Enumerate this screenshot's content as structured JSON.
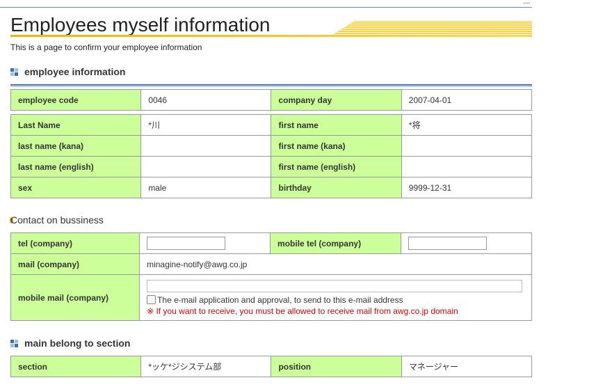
{
  "page": {
    "title": "Employees myself information",
    "subtitle": "This is a page to confirm your employee information"
  },
  "sections": {
    "employee_info": "employee information",
    "contact": "Contact on bussiness",
    "main_section": "main belong to section"
  },
  "employee_code_row": {
    "code_label": "employee code",
    "code_value": "0046",
    "company_day_label": "company day",
    "company_day_value": "2007-04-01"
  },
  "name_rows": {
    "last_name_label": "Last Name",
    "last_name_value": "*川",
    "first_name_label": "first name",
    "first_name_value": "*将",
    "last_kana_label": "last name (kana)",
    "last_kana_value": "",
    "first_kana_label": "first name (kana)",
    "first_kana_value": "",
    "last_en_label": "last name (english)",
    "last_en_value": "",
    "first_en_label": "first name (english)",
    "first_en_value": "",
    "sex_label": "sex",
    "sex_value": "male",
    "birthday_label": "birthday",
    "birthday_value": "9999-12-31"
  },
  "contact": {
    "tel_label": "tel (company)",
    "tel_value": "",
    "mobile_tel_label": "mobile tel (company)",
    "mobile_tel_value": "",
    "mail_label": "mail (company)",
    "mail_value": "minagine-notify@awg.co.jp",
    "mobile_mail_label": "mobile mail (company)",
    "mobile_mail_value": "",
    "approval_checkbox_label": "The e-mail application and approval, to send to this e-mail address",
    "approval_checked": false,
    "warning": "※ If you want to receive, you must be allowed to receive mail from awg.co.jp domain"
  },
  "belong": {
    "section_label": "section",
    "section_value": "*ッケ*ジシステム部",
    "position_label": "position",
    "position_value": "マネージャー"
  },
  "colors": {
    "label_bg": "#ccff99",
    "accent_blue": "#3b6fd1",
    "title_accent": "#f2b400",
    "warning": "#e00000"
  }
}
